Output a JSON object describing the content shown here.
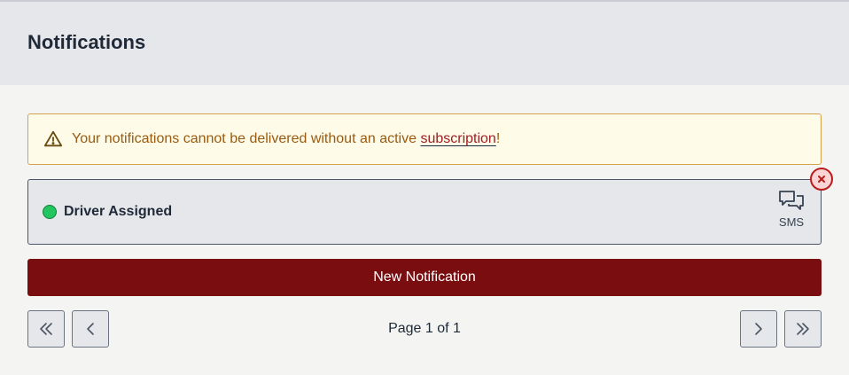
{
  "header": {
    "title": "Notifications"
  },
  "warning": {
    "icon": "warning-triangle-icon",
    "text_before": "Your notifications cannot be delivered without an active ",
    "link_label": "subscription",
    "text_after": "!"
  },
  "notification": {
    "status": "active",
    "status_color": "#22c55e",
    "title": "Driver Assigned",
    "channel_icon": "chat-bubbles-icon",
    "channel_label": "SMS",
    "close_icon": "close-icon"
  },
  "actions": {
    "new_label": "New Notification"
  },
  "pagination": {
    "label": "Page 1 of 1",
    "current_page": 1,
    "total_pages": 1,
    "first_icon": "chevrons-left-icon",
    "prev_icon": "chevron-left-icon",
    "next_icon": "chevron-right-icon",
    "last_icon": "chevrons-right-icon"
  },
  "colors": {
    "brand": "#7a0d10",
    "warning_bg": "#fefce8",
    "warning_text": "#9a5a10"
  }
}
